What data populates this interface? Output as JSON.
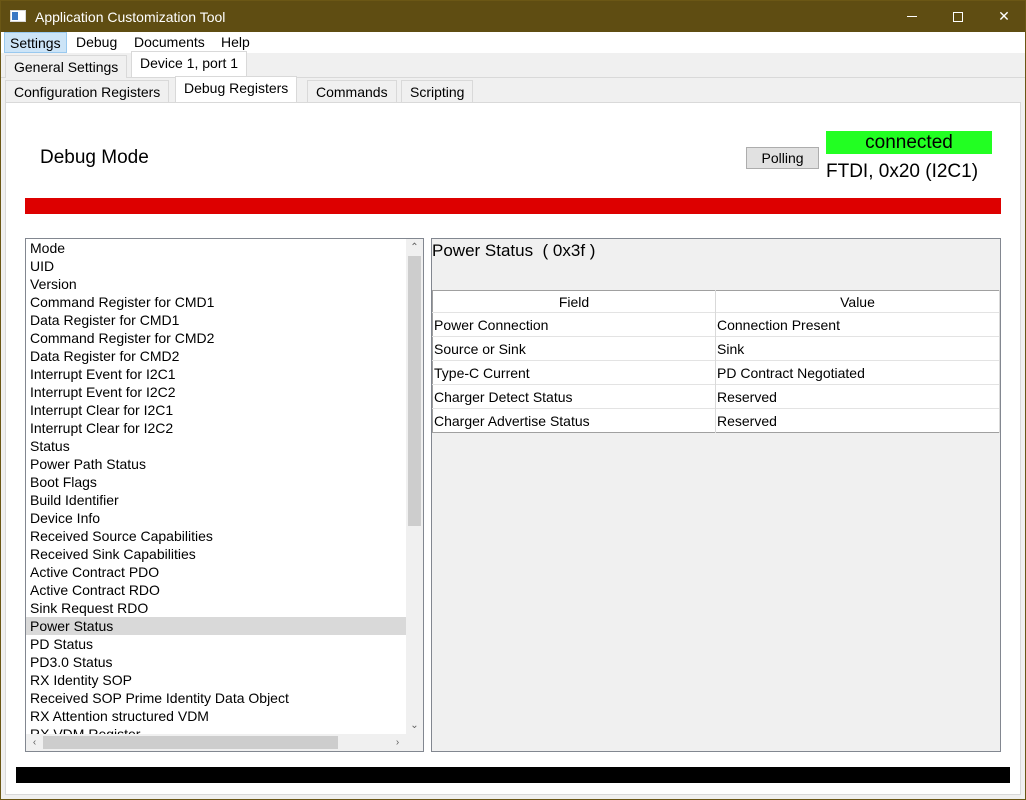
{
  "window": {
    "title": "Application Customization Tool"
  },
  "menu": [
    "Settings",
    "Debug",
    "Documents",
    "Help"
  ],
  "tabs_top": [
    "General Settings",
    "Device 1, port 1"
  ],
  "tabs_sub": [
    "Configuration Registers",
    "Debug Registers",
    "Commands",
    "Scripting"
  ],
  "header": {
    "mode_title": "Debug Mode",
    "polling_label": "Polling",
    "connection_status": "connected",
    "connection_info": "FTDI, 0x20 (I2C1)"
  },
  "colors": {
    "status_bar": "#dd0000",
    "connected": "#22ff22",
    "footer_bar": "#000000"
  },
  "registers": [
    "Mode",
    "UID",
    "Version",
    "Command Register for CMD1",
    "Data Register for CMD1",
    "Command Register for CMD2",
    "Data Register for CMD2",
    "Interrupt Event for I2C1",
    "Interrupt Event for I2C2",
    "Interrupt Clear for I2C1",
    "Interrupt Clear for I2C2",
    "Status",
    "Power Path Status",
    "Boot Flags",
    "Build Identifier",
    "Device Info",
    "Received Source Capabilities",
    "Received Sink Capabilities",
    "Active Contract PDO",
    "Active Contract RDO",
    "Sink Request RDO",
    "Power Status",
    "PD Status",
    "PD3.0 Status",
    "RX Identity SOP",
    "Received SOP Prime Identity Data Object",
    "RX Attention structured VDM",
    "RX VDM Register"
  ],
  "selected_register": "Power Status",
  "detail": {
    "title": "Power Status  ( 0x3f )",
    "columns": [
      "Field",
      "Value"
    ],
    "rows": [
      [
        "Power Connection",
        "Connection Present"
      ],
      [
        "Source or Sink",
        "Sink"
      ],
      [
        "Type-C Current",
        "PD Contract Negotiated"
      ],
      [
        "Charger Detect Status",
        "Reserved"
      ],
      [
        "Charger Advertise Status",
        "Reserved"
      ]
    ]
  },
  "icons": [
    "app-icon",
    "minimize-icon",
    "maximize-icon",
    "close-icon",
    "scroll-up-icon",
    "scroll-down-icon",
    "scroll-left-icon",
    "scroll-right-icon"
  ]
}
